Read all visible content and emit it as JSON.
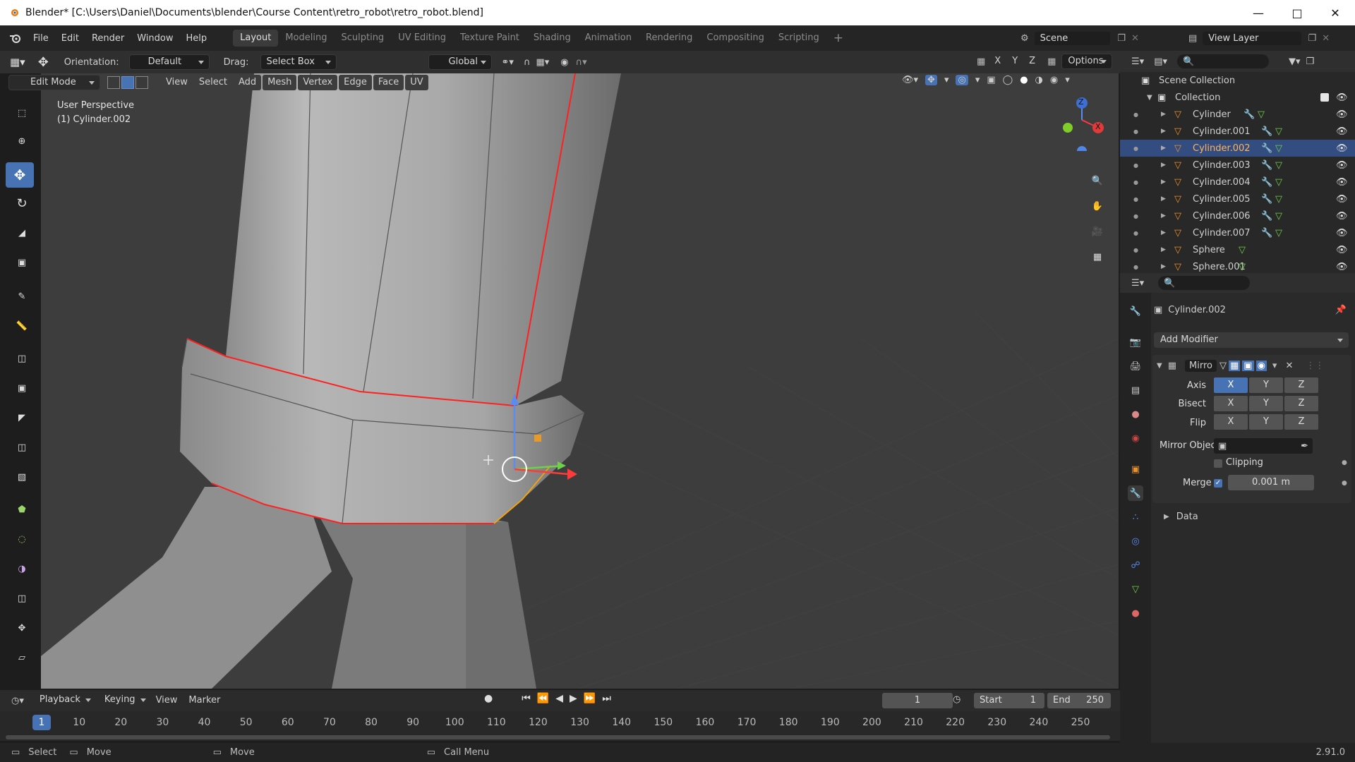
{
  "window": {
    "title": "Blender* [C:\\Users\\Daniel\\Documents\\blender\\Course Content\\retro_robot\\retro_robot.blend]"
  },
  "menu": [
    "File",
    "Edit",
    "Render",
    "Window",
    "Help"
  ],
  "workspaces": [
    "Layout",
    "Modeling",
    "Sculpting",
    "UV Editing",
    "Texture Paint",
    "Shading",
    "Animation",
    "Rendering",
    "Compositing",
    "Scripting"
  ],
  "scene": {
    "scene_label": "Scene",
    "view_layer_label": "View Layer"
  },
  "tool_header": {
    "orientation_label": "Orientation:",
    "orientation_value": "Default",
    "drag_label": "Drag:",
    "drag_value": "Select Box",
    "transform_orientation": "Global",
    "options_label": "Options",
    "axes": [
      "X",
      "Y",
      "Z"
    ]
  },
  "viewport_header": {
    "mode": "Edit Mode",
    "menus": [
      "View",
      "Select",
      "Add",
      "Mesh",
      "Vertex",
      "Edge",
      "Face",
      "UV"
    ]
  },
  "viewport": {
    "perspective_label": "User Perspective",
    "object_label": "(1) Cylinder.002",
    "gizmo_x": "X",
    "gizmo_z": "Z"
  },
  "outliner": {
    "scene_collection": "Scene Collection",
    "collection": "Collection",
    "objects": [
      {
        "name": "Cylinder",
        "selected": false
      },
      {
        "name": "Cylinder.001",
        "selected": false
      },
      {
        "name": "Cylinder.002",
        "selected": true
      },
      {
        "name": "Cylinder.003",
        "selected": false
      },
      {
        "name": "Cylinder.004",
        "selected": false
      },
      {
        "name": "Cylinder.005",
        "selected": false
      },
      {
        "name": "Cylinder.006",
        "selected": false
      },
      {
        "name": "Cylinder.007",
        "selected": false
      },
      {
        "name": "Sphere",
        "selected": false
      },
      {
        "name": "Sphere.001",
        "selected": false
      }
    ]
  },
  "properties": {
    "object_name": "Cylinder.002",
    "add_modifier": "Add Modifier",
    "modifier_name": "Mirro",
    "axis_label": "Axis",
    "bisect_label": "Bisect",
    "flip_label": "Flip",
    "axes": [
      "X",
      "Y",
      "Z"
    ],
    "mirror_object_label": "Mirror Object",
    "clipping_label": "Clipping",
    "merge_label": "Merge",
    "merge_value": "0.001 m",
    "data_label": "Data"
  },
  "timeline": {
    "menus": [
      "Playback",
      "Keying",
      "View",
      "Marker"
    ],
    "current_frame": "1",
    "start_label": "Start",
    "start_value": "1",
    "end_label": "End",
    "end_value": "250",
    "ticks": [
      "1",
      "10",
      "20",
      "30",
      "40",
      "50",
      "60",
      "70",
      "80",
      "90",
      "100",
      "110",
      "120",
      "130",
      "140",
      "150",
      "160",
      "170",
      "180",
      "190",
      "200",
      "210",
      "220",
      "230",
      "240",
      "250"
    ]
  },
  "statusbar": {
    "select": "Select",
    "move1": "Move",
    "move2": "Move",
    "call_menu": "Call Menu",
    "version": "2.91.0"
  },
  "colors": {
    "accent": "#4772b3",
    "selected_edge": "#ff2020",
    "viewport_bg": "#3d3d3d"
  }
}
